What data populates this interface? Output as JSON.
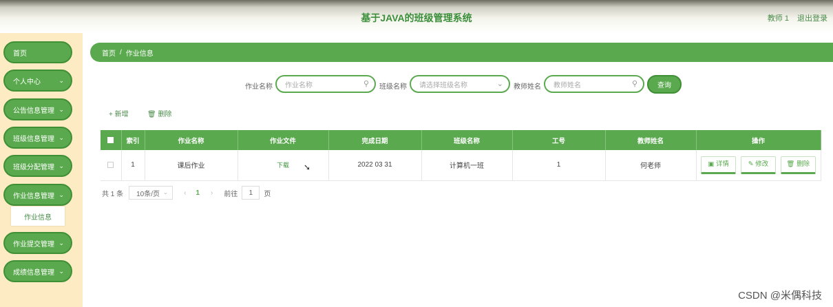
{
  "header": {
    "title": "基于JAVA的班级管理系统",
    "user": "教师 1",
    "logout": "退出登录"
  },
  "sidebar": {
    "items": [
      {
        "label": "首页",
        "has_chevron": false
      },
      {
        "label": "个人中心",
        "has_chevron": true
      },
      {
        "label": "公告信息管理",
        "has_chevron": true
      },
      {
        "label": "班级信息管理",
        "has_chevron": true
      },
      {
        "label": "班级分配管理",
        "has_chevron": true
      },
      {
        "label": "作业信息管理",
        "has_chevron": true
      },
      {
        "label": "作业提交管理",
        "has_chevron": true
      },
      {
        "label": "成绩信息管理",
        "has_chevron": true
      }
    ],
    "submenu": {
      "label": "作业信息"
    }
  },
  "breadcrumb": {
    "home": "首页",
    "separator": "/",
    "current": "作业信息"
  },
  "search": {
    "fields": [
      {
        "label": "作业名称",
        "placeholder": "作业名称",
        "icon": "search-icon"
      },
      {
        "label": "班级名称",
        "placeholder": "请选择班级名称",
        "icon": "chevron-down-icon"
      },
      {
        "label": "教师姓名",
        "placeholder": "教师姓名",
        "icon": "search-icon"
      }
    ],
    "button": "查询"
  },
  "actions": {
    "add": "新增",
    "add_icon": "plus-icon",
    "delete": "删除",
    "delete_icon": "trash-icon"
  },
  "table": {
    "headers": [
      "索引",
      "作业名称",
      "作业文件",
      "完成日期",
      "班级名称",
      "工号",
      "教师姓名",
      "操作"
    ],
    "rows": [
      {
        "index": "1",
        "name": "课后作业",
        "file": "下载",
        "date": "2022 03 31",
        "class": "计算机一班",
        "job_no": "1",
        "teacher": "何老师"
      }
    ],
    "row_buttons": [
      "详情",
      "修改",
      "删除"
    ]
  },
  "pagination": {
    "total": "共 1 条",
    "page_size": "10条/页",
    "current_page": "1",
    "goto_label": "前往",
    "goto_value": "1",
    "page_suffix": "页"
  },
  "watermark": "CSDN @米偶科技",
  "colors": {
    "primary_green": "#5aa94e",
    "sidebar_bg": "#fdebc3"
  }
}
